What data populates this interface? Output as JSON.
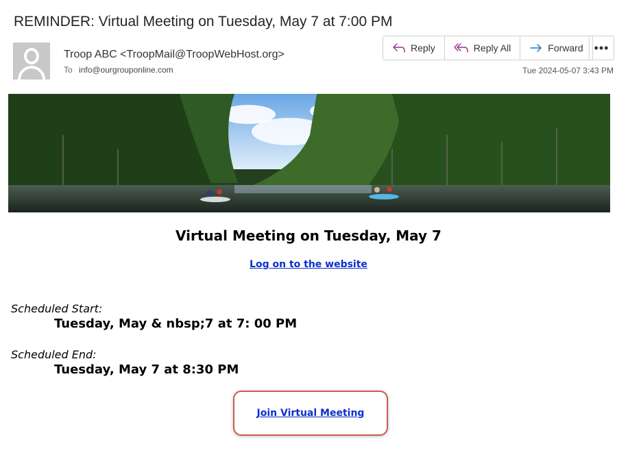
{
  "email": {
    "subject": "REMINDER: Virtual Meeting on Tuesday, May 7 at 7:00 PM",
    "sender": "Troop ABC <TroopMail@TroopWebHost.org>",
    "to_label": "To",
    "to_address": "info@ourgrouponline.com",
    "timestamp": "Tue 2024-05-07 3:43 PM"
  },
  "actions": {
    "reply": "Reply",
    "reply_all": "Reply All",
    "forward": "Forward",
    "more": "•••"
  },
  "body": {
    "heading": "Virtual Meeting on Tuesday, May 7",
    "logon_link": "Log on to the website",
    "start_label": "Scheduled Start:",
    "start_value": "Tuesday, May & nbsp;7 at 7: 00 PM",
    "end_label": "Scheduled End:",
    "end_value": "Tuesday, May 7 at 8:30 PM",
    "join_link": "Join Virtual Meeting"
  },
  "icons": {
    "reply": "reply-arrow-icon",
    "reply_all": "reply-all-arrow-icon",
    "forward": "forward-arrow-icon",
    "more": "more-options-icon",
    "avatar": "default-avatar-icon"
  },
  "colors": {
    "link": "#0b2fd0",
    "join_border": "#c95a4c",
    "reply_icon": "#9a2f8f",
    "forward_icon": "#1f78c8"
  }
}
